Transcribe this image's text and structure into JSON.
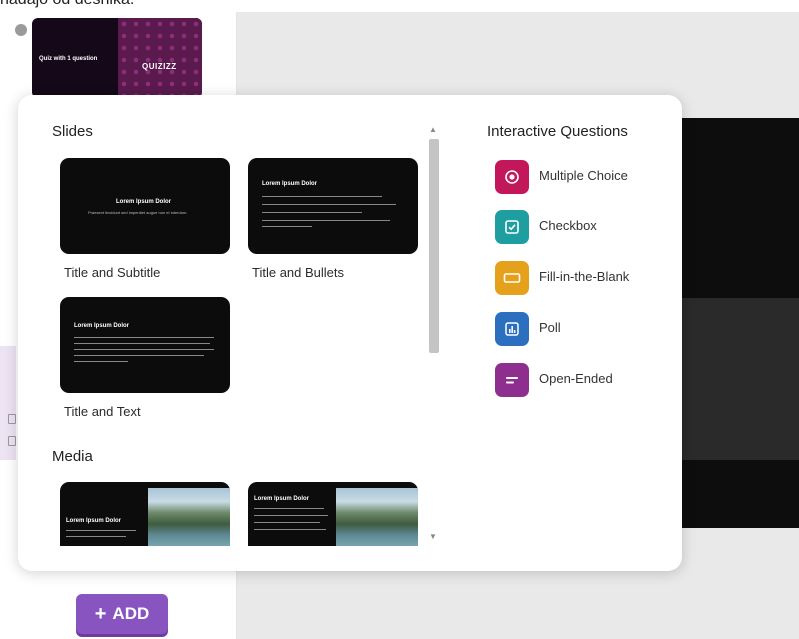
{
  "top_text": "nadajo od desnika.",
  "thumbnail": {
    "title": "Quiz with 1 question",
    "logo": "QUIZIZZ"
  },
  "add_button": {
    "plus": "+",
    "label": "ADD"
  },
  "popup": {
    "slides_heading": "Slides",
    "media_heading": "Media",
    "interactive_heading": "Interactive Questions",
    "slide_cards": [
      {
        "label": "Title and Subtitle",
        "title": "Lorem Ipsum Dolor",
        "subtitle": "Praesent tincidunt sed imperdiet augue non et interdum."
      },
      {
        "label": "Title and Bullets",
        "title": "Lorem Ipsum Dolor"
      },
      {
        "label": "Title and Text",
        "title": "Lorem Ipsum Dolor"
      }
    ],
    "media_cards": [
      {
        "title": "Lorem Ipsum Dolor"
      },
      {
        "title": "Lorem Ipsum Dolor"
      }
    ],
    "questions": [
      {
        "label": "Multiple Choice",
        "color": "#c2185b",
        "icon": "radio-button-icon"
      },
      {
        "label": "Checkbox",
        "color": "#1e9ea0",
        "icon": "checkbox-icon"
      },
      {
        "label": "Fill-in-the-Blank",
        "color": "#e5a01c",
        "icon": "blank-field-icon"
      },
      {
        "label": "Poll",
        "color": "#2d6fbf",
        "icon": "poll-chart-icon"
      },
      {
        "label": "Open-Ended",
        "color": "#8e2f8f",
        "icon": "text-lines-icon"
      }
    ]
  }
}
